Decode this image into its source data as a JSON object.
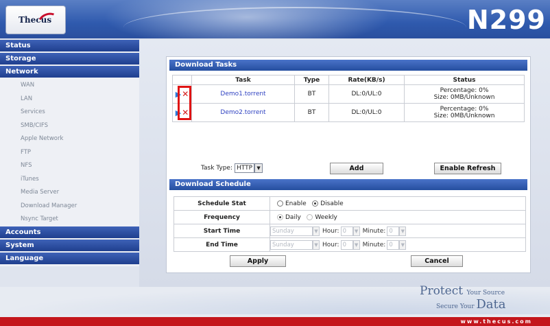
{
  "header": {
    "logo_text": "Thecus",
    "model": "N299"
  },
  "sidebar": {
    "categories": {
      "status": "Status",
      "storage": "Storage",
      "network": "Network",
      "accounts": "Accounts",
      "system": "System",
      "language": "Language"
    },
    "network_items": [
      "WAN",
      "LAN",
      "Services",
      "SMB/CIFS",
      "Apple Network",
      "FTP",
      "NFS",
      "iTunes",
      "Media Server",
      "Download Manager",
      "Nsync Target"
    ]
  },
  "download_tasks": {
    "title": "Download Tasks",
    "columns": [
      "Task",
      "Type",
      "Rate(KB/s)",
      "Status"
    ],
    "rows": [
      {
        "task": "Demo1.torrent",
        "type": "BT",
        "rate": "DL:0/UL:0",
        "status_line1": "Percentage: 0%",
        "status_line2": "Size: 0MB/Unknown"
      },
      {
        "task": "Demo2.torrent",
        "type": "BT",
        "rate": "DL:0/UL:0",
        "status_line1": "Percentage: 0%",
        "status_line2": "Size: 0MB/Unknown"
      }
    ],
    "task_type_label": "Task Type:",
    "task_type_value": "HTTP",
    "add_label": "Add",
    "refresh_label": "Enable Refresh"
  },
  "download_schedule": {
    "title": "Download Schedule",
    "schedule_stat_label": "Schedule Stat",
    "enable_label": "Enable",
    "disable_label": "Disable",
    "selected": "Disable",
    "frequency_label": "Frequency",
    "daily_label": "Daily",
    "weekly_label": "Weekly",
    "start_time_label": "Start Time",
    "end_time_label": "End Time",
    "day_value": "Sunday",
    "hour_label": "Hour:",
    "hour_value": "0",
    "minute_label": "Minute:",
    "minute_value": "0",
    "apply_label": "Apply",
    "cancel_label": "Cancel"
  },
  "footer": {
    "slogan_protect": "Protect",
    "slogan_your_source": "Your Source",
    "slogan_secure": "Secure Your",
    "slogan_data": "Data",
    "url": "www.thecus.com"
  },
  "colors": {
    "header_blue": "#2f5aae",
    "section_blue": "#254e9f",
    "highlight_red": "#e01313",
    "footer_red": "#c4161c"
  }
}
